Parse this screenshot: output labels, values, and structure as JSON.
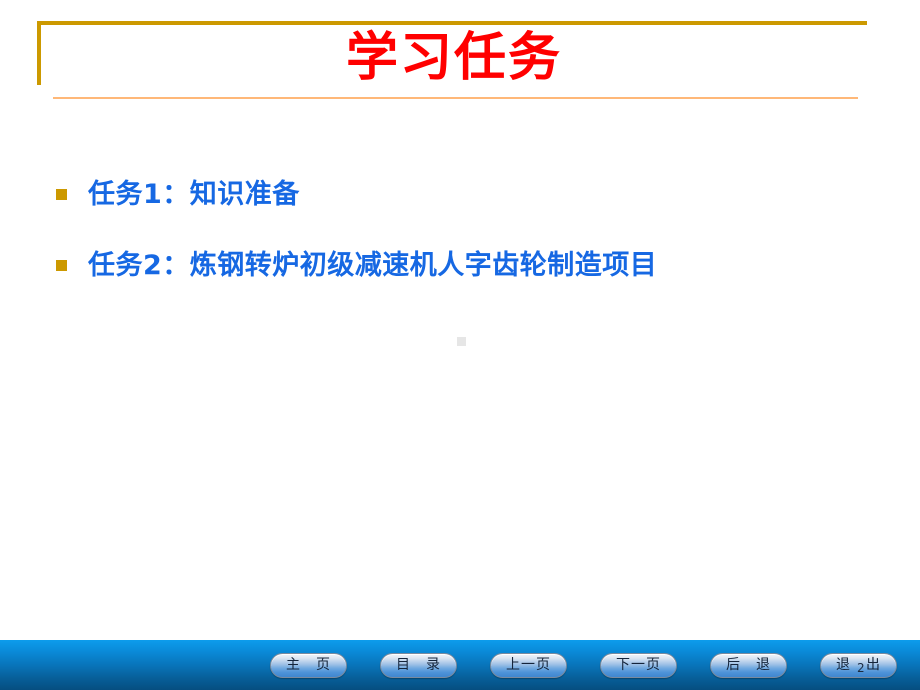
{
  "slide": {
    "title": "学习任务",
    "accent_gold": "#CC9900",
    "accent_light_orange": "#FFB878",
    "title_color": "#FF0000",
    "bullet_text_color": "#1668E3",
    "bullets": [
      {
        "marker": "square-bullet",
        "text": "任务1：知识准备"
      },
      {
        "marker": "square-bullet",
        "text": "任务2：炼钢转炉初级减速机人字齿轮制造项目"
      }
    ]
  },
  "nav": {
    "bar_color_top": "#0C9CEC",
    "bar_color_bottom": "#064E80",
    "slide_number": "2",
    "buttons": [
      {
        "label": "主　页",
        "name": "home"
      },
      {
        "label": "目　录",
        "name": "contents"
      },
      {
        "label": "上一页",
        "name": "previous-page"
      },
      {
        "label": "下一页",
        "name": "next-page"
      },
      {
        "label": "后　退",
        "name": "back"
      },
      {
        "label": "退　出",
        "name": "exit"
      }
    ]
  }
}
